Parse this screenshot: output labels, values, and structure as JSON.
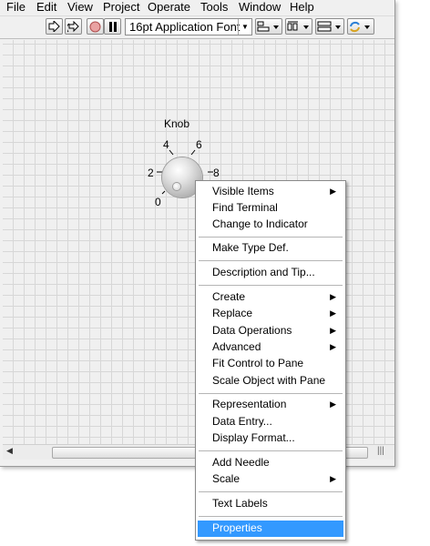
{
  "menubar": {
    "items": [
      "File",
      "Edit",
      "View",
      "Project",
      "Operate",
      "Tools",
      "Window",
      "Help"
    ]
  },
  "toolbar": {
    "font": "16pt Application Font",
    "buttons": [
      "run-arrow-icon",
      "run-continuously-icon",
      "abort-icon",
      "pause-icon",
      "align-objects-icon",
      "distribute-objects-icon",
      "resize-objects-icon",
      "reorder-icon"
    ]
  },
  "knob": {
    "label": "Knob",
    "ticks": [
      "0",
      "2",
      "4",
      "6",
      "8"
    ]
  },
  "context_menu": {
    "items": [
      {
        "label": "Visible Items",
        "submenu": true
      },
      {
        "label": "Find Terminal",
        "submenu": false
      },
      {
        "label": "Change to Indicator",
        "submenu": false
      },
      {
        "label": "Make Type Def.",
        "submenu": false
      },
      {
        "label": "Description and Tip...",
        "submenu": false
      },
      {
        "label": "Create",
        "submenu": true
      },
      {
        "label": "Replace",
        "submenu": true
      },
      {
        "label": "Data Operations",
        "submenu": true
      },
      {
        "label": "Advanced",
        "submenu": true
      },
      {
        "label": "Fit Control to Pane",
        "submenu": false
      },
      {
        "label": "Scale Object with Pane",
        "submenu": false
      },
      {
        "label": "Representation",
        "submenu": true
      },
      {
        "label": "Data Entry...",
        "submenu": false
      },
      {
        "label": "Display Format...",
        "submenu": false
      },
      {
        "label": "Add Needle",
        "submenu": false
      },
      {
        "label": "Scale",
        "submenu": true
      },
      {
        "label": "Text Labels",
        "submenu": false
      },
      {
        "label": "Properties",
        "submenu": false,
        "selected": true
      }
    ],
    "submenu_glyph": "▶",
    "selection_color": "#3399ff"
  },
  "scrollbar": {
    "grip": "|||"
  }
}
